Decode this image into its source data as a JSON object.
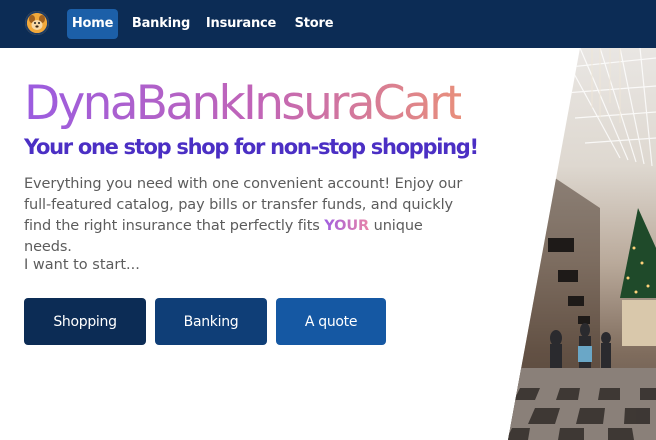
{
  "nav": {
    "logo_icon": "dog-mascot-logo",
    "links": [
      {
        "label": "Home",
        "active": true
      },
      {
        "label": "Banking",
        "active": false
      },
      {
        "label": "Insurance",
        "active": false
      },
      {
        "label": "Store",
        "active": false
      }
    ]
  },
  "hero": {
    "title": "DynaBankInsuraCart",
    "tagline": "Your one stop shop for non-stop shopping!",
    "description_before": "Everything you need with one convenient account! Enjoy our full-featured catalog, pay bills or transfer funds, and quickly find the right insurance that perfectly fits ",
    "description_emphasis": "YOUR",
    "description_after": " unique needs.",
    "start_prompt": "I want to start...",
    "buttons": [
      {
        "label": "Shopping"
      },
      {
        "label": "Banking"
      },
      {
        "label": "A quote"
      }
    ],
    "image": "shopping-arcade-with-christmas-tree-photo"
  },
  "colors": {
    "navbar": "#0c2c55",
    "nav_active": "#1c5fa8",
    "tagline": "#4b2fc4",
    "button_shopping": "#0c2c55",
    "button_banking": "#0f3e77",
    "button_quote": "#1558a3"
  }
}
